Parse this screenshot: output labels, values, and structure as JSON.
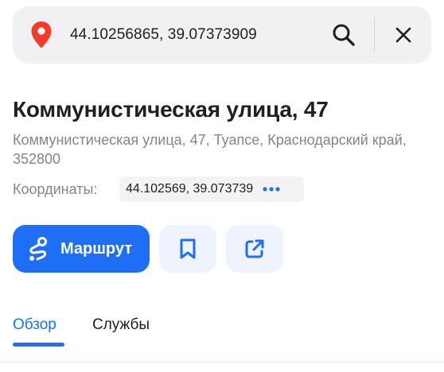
{
  "search": {
    "query": "44.10256865, 39.07373909"
  },
  "place": {
    "title": "Коммунистическая улица, 47",
    "address": "Коммунистическая улица, 47, Туапсе, Краснодарский край, 352800",
    "coords_label": "Координаты:",
    "coords_value": "44.102569, 39.073739"
  },
  "actions": {
    "route_label": "Маршрут"
  },
  "tabs": [
    {
      "label": "Обзор",
      "active": true
    },
    {
      "label": "Службы",
      "active": false
    }
  ],
  "colors": {
    "accent": "#1e6ff5",
    "pin": "#f43b27",
    "secondary_text": "#858585"
  },
  "icons": [
    "location-pin-icon",
    "search-icon",
    "close-icon",
    "more-icon",
    "route-icon",
    "bookmark-icon",
    "share-icon"
  ]
}
